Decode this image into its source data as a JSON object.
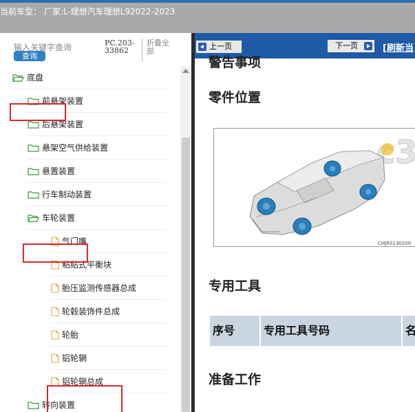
{
  "window": {
    "title": "当前车型： 厂家:L-理想汽车理想L92022-2023"
  },
  "search": {
    "placeholder": "输入关键字查询",
    "query_button": "查询",
    "code": "PC.203-33862",
    "fold_all": "折叠全部"
  },
  "tree": [
    {
      "label": "底盘",
      "type": "folder",
      "level": 0,
      "highlighted": true
    },
    {
      "label": "前悬架装置",
      "type": "folder",
      "level": 1
    },
    {
      "label": "后悬架装置",
      "type": "folder",
      "level": 1
    },
    {
      "label": "悬架空气供给装置",
      "type": "folder",
      "level": 1
    },
    {
      "label": "悬置装置",
      "type": "folder",
      "level": 1
    },
    {
      "label": "行车制动装置",
      "type": "folder",
      "level": 1
    },
    {
      "label": "车轮装置",
      "type": "folder",
      "level": 1,
      "highlighted": true
    },
    {
      "label": "气门嘴",
      "type": "document",
      "level": 2
    },
    {
      "label": "粘贴式平衡块",
      "type": "document",
      "level": 2
    },
    {
      "label": "胎压监测传感器总成",
      "type": "document",
      "level": 2
    },
    {
      "label": "轮毂装饰件总成",
      "type": "document",
      "level": 2
    },
    {
      "label": "轮胎",
      "type": "document",
      "level": 2
    },
    {
      "label": "铝轮辋",
      "type": "document",
      "level": 2,
      "highlighted": true
    },
    {
      "label": "铝轮辋总成",
      "type": "document",
      "level": 2,
      "highlighted": true
    },
    {
      "label": "转向装置",
      "type": "folder",
      "level": 1
    }
  ],
  "nav": {
    "prev": "上一页",
    "next": "下一页",
    "refresh": "[刷新当"
  },
  "content": {
    "partial_heading": "警告事项",
    "section_parts": "零件位置",
    "figure_code": "CHJRS130200",
    "section_tools": "专用工具",
    "table_headers": [
      "序号",
      "专用工具号码",
      "名"
    ],
    "section_prep": "准备工作"
  },
  "colors": {
    "accent_blue": "#1e5aa6",
    "highlight_red": "#d9262c",
    "folder_green": "#3a9a3a",
    "doc_orange": "#e8a040",
    "wheel_blue": "#2a7fb8"
  }
}
